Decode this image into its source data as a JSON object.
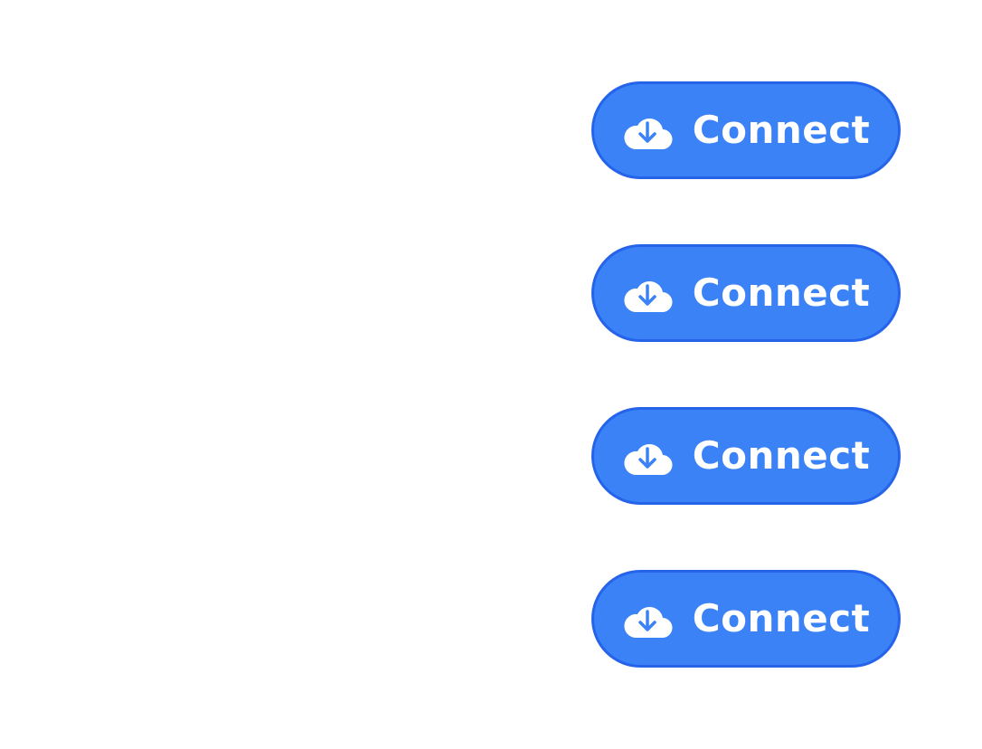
{
  "theme": {
    "button_fill": "#3b82f6",
    "button_border": "#2563eb",
    "label_color": "#ffffff",
    "background": "#ffffff"
  },
  "buttons": [
    {
      "label": "Connect",
      "icon": "cloud-download-icon"
    },
    {
      "label": "Connect",
      "icon": "cloud-download-icon"
    },
    {
      "label": "Connect",
      "icon": "cloud-download-icon"
    },
    {
      "label": "Connect",
      "icon": "cloud-download-icon"
    }
  ]
}
